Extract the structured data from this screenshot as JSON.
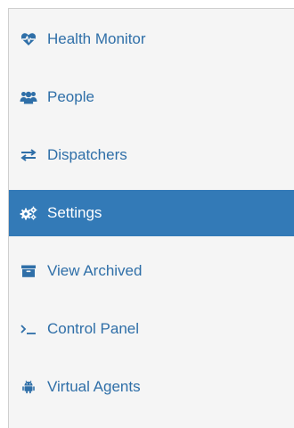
{
  "colors": {
    "link": "#2f6fa8",
    "active_bg": "#337ab7",
    "active_text": "#ffffff",
    "sidebar_bg": "#f5f5f5"
  },
  "nav": {
    "items": [
      {
        "label": "Health Monitor",
        "icon": "heartbeat-icon",
        "active": false
      },
      {
        "label": "People",
        "icon": "users-icon",
        "active": false
      },
      {
        "label": "Dispatchers",
        "icon": "exchange-icon",
        "active": false
      },
      {
        "label": "Settings",
        "icon": "cogs-icon",
        "active": true
      },
      {
        "label": "View Archived",
        "icon": "archive-icon",
        "active": false
      },
      {
        "label": "Control Panel",
        "icon": "terminal-icon",
        "active": false
      },
      {
        "label": "Virtual Agents",
        "icon": "android-icon",
        "active": false
      }
    ]
  }
}
